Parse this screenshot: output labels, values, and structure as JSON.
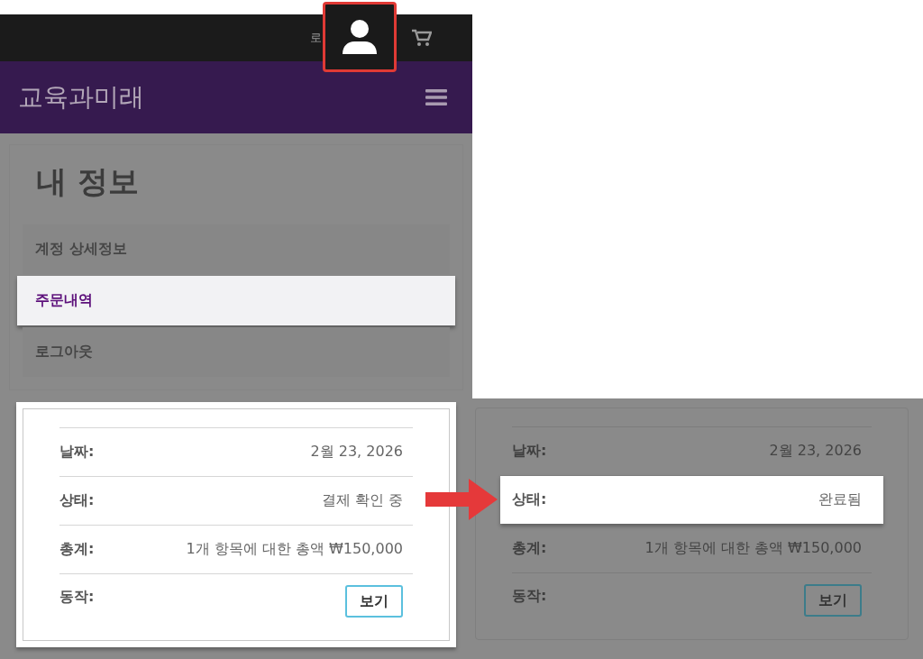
{
  "top_bar": {
    "login_text": "로",
    "user_button_highlighted": true
  },
  "header": {
    "brand": "교육과미래"
  },
  "page": {
    "title": "내 정보",
    "menu": [
      {
        "label": "계정 상세정보",
        "selected": false
      },
      {
        "label": "주문내역",
        "selected": true
      },
      {
        "label": "로그아웃",
        "selected": false
      }
    ]
  },
  "order_card": {
    "highlighted": true,
    "rows": [
      {
        "kind": "text",
        "label": "날짜:",
        "value": "2월 23, 2026"
      },
      {
        "kind": "text",
        "label": "상태:",
        "value": "결제 확인 중"
      },
      {
        "kind": "text",
        "label": "총계:",
        "value": "1개 항목에 대한 총액 ₩150,000"
      },
      {
        "kind": "button",
        "label": "동작:",
        "value": "보기"
      }
    ]
  },
  "zoomed_card": {
    "highlighted": false,
    "rows": [
      {
        "kind": "text",
        "label": "날짜:",
        "value": "2월 23, 2026",
        "highlighted": false
      },
      {
        "kind": "text",
        "label": "상태:",
        "value": "완료됨",
        "highlighted": true
      },
      {
        "kind": "text",
        "label": "총계:",
        "value": "1개 항목에 대한 총액 ₩150,000",
        "highlighted": false
      },
      {
        "kind": "button",
        "label": "동작:",
        "value": "보기",
        "highlighted": false
      }
    ]
  }
}
